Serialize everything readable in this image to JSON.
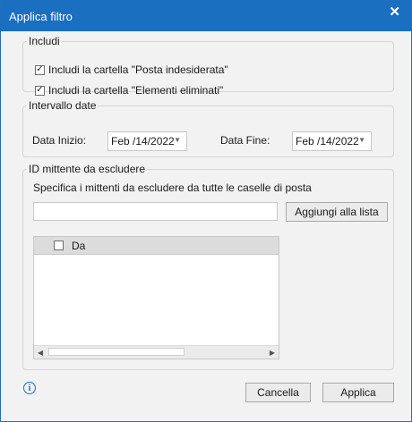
{
  "dialog": {
    "title": "Applica filtro",
    "close_glyph": "✕"
  },
  "includi": {
    "legend": "Includi",
    "options": [
      {
        "label": "Includi la cartella \"Posta indesiderata\"",
        "checked": true
      },
      {
        "label": "Includi la cartella \"Elementi eliminati\"",
        "checked": true
      }
    ]
  },
  "intervallo": {
    "legend": "Intervallo date",
    "start_label": "Data Inizio:",
    "start_value": "Feb /14/2022",
    "end_label": "Data Fine:",
    "end_value": "Feb /14/2022"
  },
  "mittenti": {
    "legend": "ID mittente da escludere",
    "description": "Specifica i mittenti da escludere da tutte le caselle di posta",
    "input_value": "",
    "add_button": "Aggiungi alla lista",
    "column_header": "Da",
    "header_checked": false
  },
  "footer": {
    "info_icon": "info-icon",
    "cancel_button": "Cancella",
    "apply_button": "Applica"
  },
  "colors": {
    "titlebar": "#1a6fc1",
    "accent": "#1a6fc1"
  }
}
